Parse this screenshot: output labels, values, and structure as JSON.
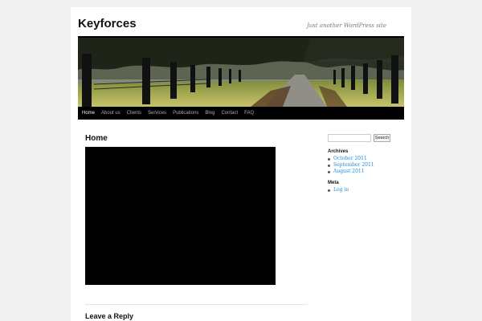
{
  "site": {
    "title": "Keyforces",
    "description": "Just another WordPress site"
  },
  "nav": {
    "items": [
      {
        "label": "Home",
        "current": true
      },
      {
        "label": "About us"
      },
      {
        "label": "Clients"
      },
      {
        "label": "Services"
      },
      {
        "label": "Publications"
      },
      {
        "label": "Blog"
      },
      {
        "label": "Contact"
      },
      {
        "label": "FAQ"
      }
    ]
  },
  "main": {
    "entry_title": "Home",
    "reply_title": "Leave a Reply"
  },
  "sidebar": {
    "search": {
      "placeholder": "",
      "button_label": "Search"
    },
    "archives": {
      "title": "Archives",
      "items": [
        "October 2011",
        "September 2011",
        "August 2011"
      ]
    },
    "meta": {
      "title": "Meta",
      "items": [
        "Log in"
      ]
    }
  },
  "colors": {
    "link": "#1b8be0",
    "nav_bg": "#000000",
    "page_bg": "#f1f1f1"
  }
}
